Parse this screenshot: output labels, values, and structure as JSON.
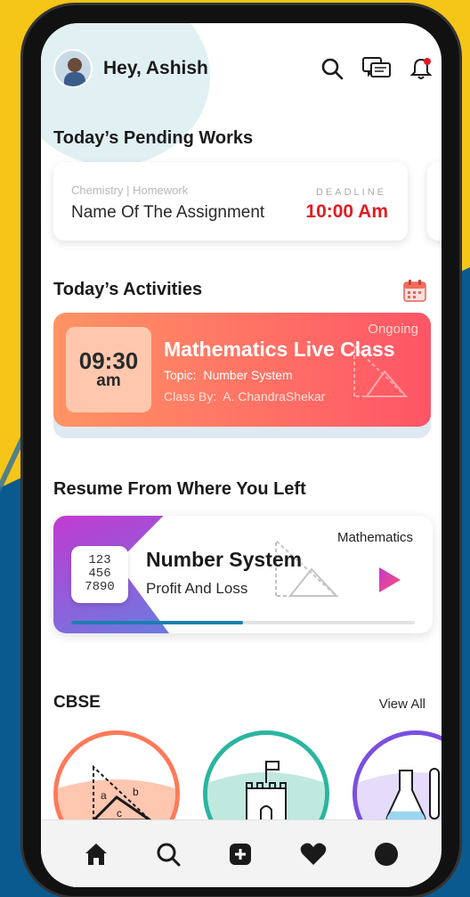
{
  "header": {
    "greeting": "Hey, Ashish"
  },
  "pending": {
    "title": "Today’s Pending Works",
    "subject": "Chemistry | Homework",
    "assignment": "Name Of The Assignment",
    "deadline_label": "DEADLINE",
    "deadline_time": "10:00 Am"
  },
  "activities": {
    "title": "Today’s Activities",
    "time": "09:30",
    "ampm": "am",
    "status": "Ongoing",
    "class_title": "Mathematics Live Class",
    "topic_label": "Topic:",
    "topic": "Number System",
    "by_label": "Class By:",
    "by": "A. ChandraShekar"
  },
  "resume": {
    "title": "Resume From Where You Left",
    "subject": "Mathematics",
    "lesson": "Number System",
    "sublesson": "Profit And Loss",
    "numbers": [
      "123",
      "456",
      "7890"
    ],
    "progress": 0.5
  },
  "cbse": {
    "title": "CBSE",
    "view_all": "View All"
  },
  "colors": {
    "accent_red": "#e11b22",
    "activity_start": "#ff9464",
    "activity_end": "#ff5566",
    "progress": "#1a7fb0"
  },
  "nav": [
    "home-icon",
    "search-icon",
    "add-icon",
    "heart-icon",
    "profile-icon"
  ]
}
